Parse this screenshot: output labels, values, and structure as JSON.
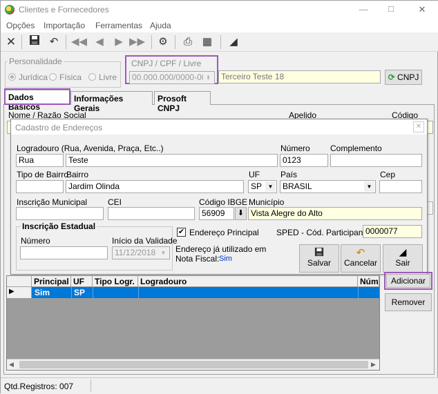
{
  "window": {
    "title": "Clientes e Fornecedores"
  },
  "menu": [
    "Opções",
    "Importação",
    "Ferramentas",
    "Ajuda"
  ],
  "personalidade": {
    "label": "Personalidade",
    "options": [
      "Jurídica",
      "Física",
      "Livre"
    ],
    "selected": "Jurídica"
  },
  "cnpj": {
    "label": "CNPJ / CPF / Livre",
    "value": "00.000.000/0000-00",
    "name_value": "Terceiro Teste 18",
    "button_label": "CNPJ"
  },
  "tabs": [
    "Dados Básicos",
    "Informações Gerais",
    "Prosoft CNPJ"
  ],
  "main_labels": {
    "nome": "Nome / Razão Social",
    "apelido": "Apelido",
    "codigo": "Código"
  },
  "dialog": {
    "title": "Cadastro de Endereços",
    "logradouro": {
      "label": "Logradouro (Rua, Avenida, Praça, Etc..)",
      "tipo": "Rua",
      "value": "Teste"
    },
    "numero": {
      "label": "Número",
      "value": "0123"
    },
    "complemento": {
      "label": "Complemento",
      "value": ""
    },
    "tipo_bairro": {
      "label": "Tipo de Bairro",
      "value": ""
    },
    "bairro": {
      "label": "Bairro",
      "value": "Jardim Olinda"
    },
    "uf": {
      "label": "UF",
      "value": "SP"
    },
    "pais": {
      "label": "País",
      "value": "BRASIL"
    },
    "cep": {
      "label": "Cep",
      "value": ""
    },
    "inscricao_municipal": {
      "label": "Inscrição Municipal",
      "value": ""
    },
    "cei": {
      "label": "CEI",
      "value": ""
    },
    "codigo_ibge": {
      "label": "Código IBGE",
      "value": "56909"
    },
    "municipio": {
      "label": "Município",
      "value": "Vista Alegre do Alto"
    },
    "inscricao_estadual": {
      "label": "Inscrição Estadual",
      "numero_label": "Número",
      "numero_value": "",
      "inicio_label": "Início da Validade",
      "inicio_value": "11/12/2018"
    },
    "endereco_principal": {
      "label": "Endereço Principal",
      "checked": true
    },
    "sped": {
      "label": "SPED - Cód. Participante:",
      "value": "0000077"
    },
    "ja_utilizado": {
      "line1": "Endereço já utilizado em",
      "line2": "Nota Fiscal:",
      "value": "Sim"
    },
    "buttons": {
      "salvar": "Salvar",
      "cancelar": "Cancelar",
      "sair": "Sair"
    }
  },
  "grid": {
    "columns": [
      "Principal",
      "UF",
      "Tipo Logr.",
      "Logradouro",
      "Núme"
    ],
    "rows": [
      {
        "principal": "Sim",
        "uf": "SP",
        "tipo": "",
        "logradouro": ""
      }
    ]
  },
  "side_buttons": {
    "adicionar": "Adicionar",
    "remover": "Remover"
  },
  "status": {
    "text": "Qtd.Registros: 007"
  },
  "colors": {
    "highlight": "#9b59b6",
    "selection": "#0078d7",
    "yellow_field": "#ffffe1"
  }
}
